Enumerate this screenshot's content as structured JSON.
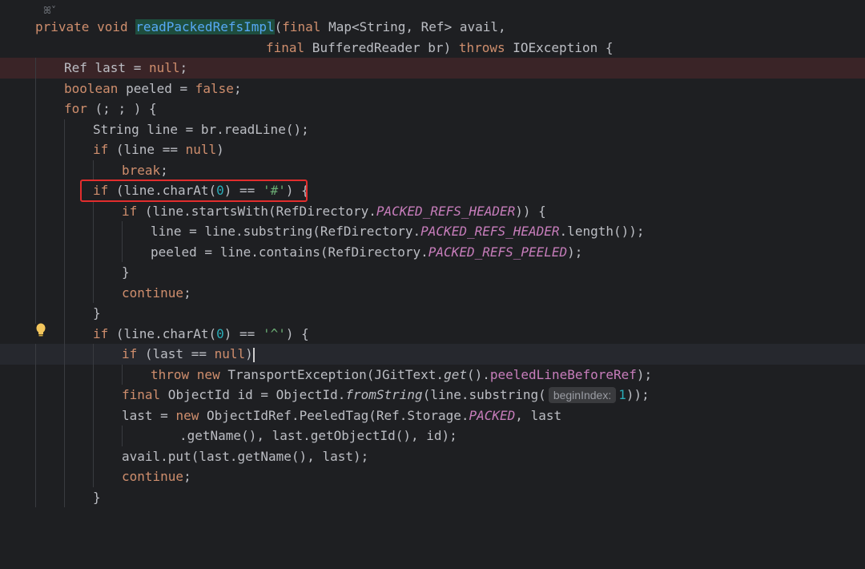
{
  "editor": {
    "top_icon": "ꕤ˅",
    "lines": [
      [
        "private void ",
        "readPackedRefsImpl",
        "(final Map<String, Ref> avail,"
      ],
      [
        "final BufferedReader br) throws IOException {"
      ],
      [
        "Ref last = null;"
      ],
      [
        "boolean peeled = false;"
      ],
      [
        "for (; ; ) {"
      ],
      [
        "String line = br.readLine();"
      ],
      [
        "if (line == null)"
      ],
      [
        "break;"
      ],
      [
        "if (line.charAt(",
        "0",
        ") == ",
        "'#'",
        ") {"
      ],
      [
        "if (line.startsWith(RefDirectory.",
        "PACKED_REFS_HEADER",
        ")) {"
      ],
      [
        "line = line.substring(RefDirectory.",
        "PACKED_REFS_HEADER",
        ".length());"
      ],
      [
        "peeled = line.contains(RefDirectory.",
        "PACKED_REFS_PEELED",
        ");"
      ],
      [
        "}"
      ],
      [
        "continue;"
      ],
      [
        "}"
      ],
      [
        "if (line.charAt(",
        "0",
        ") == ",
        "'^'",
        ") {"
      ],
      [
        "if (last == null)"
      ],
      [
        "throw new TransportException(JGitText.",
        "get",
        "().",
        "peeledLineBeforeRef",
        ");"
      ],
      [
        "final ObjectId id = ObjectId.",
        "fromString",
        "(line.substring(",
        "beginIndex:",
        "1",
        "));"
      ],
      [
        "last = new ObjectIdRef.PeeledTag(Ref.Storage.",
        "PACKED",
        ", last"
      ],
      [
        ".getName(), last.getObjectId(), id);"
      ],
      [
        "avail.put(last.getName(), last);"
      ],
      [
        "continue;"
      ],
      [
        "}"
      ]
    ]
  },
  "colors": {
    "background": "#1e1f22",
    "keyword": "#cf8e6d",
    "number": "#2aacb8",
    "string": "#6aab73",
    "static_field": "#c77dbb",
    "highlight_box": "#e22d2d"
  }
}
